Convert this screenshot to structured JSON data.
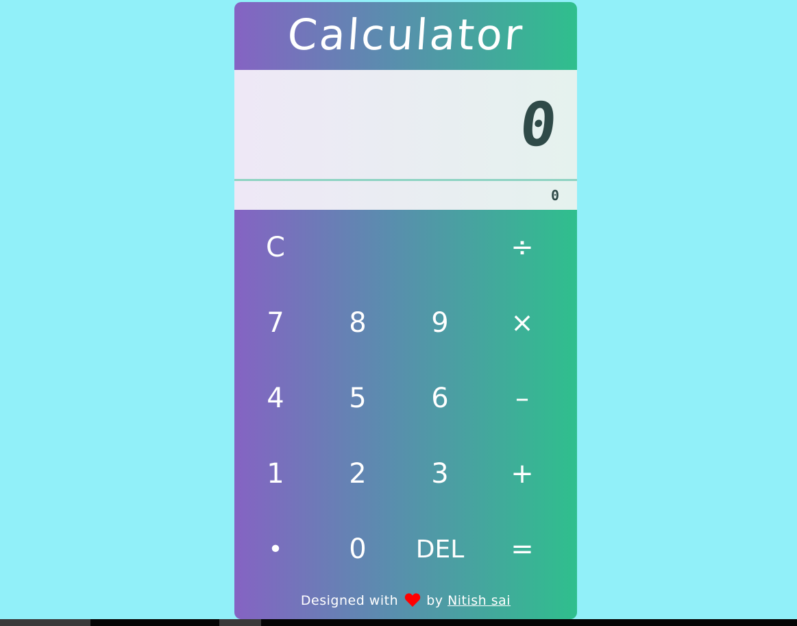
{
  "app": {
    "title": "Calculator"
  },
  "display": {
    "current": "0",
    "previous": "0"
  },
  "keys": {
    "clear": "C",
    "divide": "÷",
    "seven": "7",
    "eight": "8",
    "nine": "9",
    "multiply": "×",
    "four": "4",
    "five": "5",
    "six": "6",
    "subtract": "–",
    "one": "1",
    "two": "2",
    "three": "3",
    "add": "+",
    "decimal": "•",
    "zero": "0",
    "delete": "DEL",
    "equals": "="
  },
  "footer": {
    "prefix": "Designed with",
    "heart_icon": "heart-icon",
    "by": "by",
    "author": "Nitish sai"
  },
  "colors": {
    "background": "#91f0f9",
    "gradient_start": "#8563c3",
    "gradient_end": "#2fbf8d",
    "display_text": "#2f4a48",
    "heart": "#ff0000"
  }
}
